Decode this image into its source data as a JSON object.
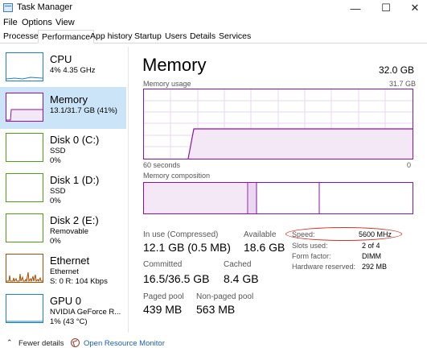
{
  "window": {
    "title": "Task Manager",
    "controls": {
      "minimize": "—",
      "maximize": "☐",
      "close": "✕"
    }
  },
  "menu": [
    "File",
    "Options",
    "View"
  ],
  "tabs": [
    {
      "label": "Processes",
      "active": false
    },
    {
      "label": "Performance",
      "active": true
    },
    {
      "label": "App history",
      "active": false
    },
    {
      "label": "Startup",
      "active": false
    },
    {
      "label": "Users",
      "active": false
    },
    {
      "label": "Details",
      "active": false
    },
    {
      "label": "Services",
      "active": false
    }
  ],
  "sidebar": {
    "items": [
      {
        "title": "CPU",
        "line1": "4% 4.35 GHz",
        "line2": "",
        "kind": "cpu",
        "selected": false
      },
      {
        "title": "Memory",
        "line1": "13.1/31.7 GB (41%)",
        "line2": "",
        "kind": "mem",
        "selected": true
      },
      {
        "title": "Disk 0 (C:)",
        "line1": "SSD",
        "line2": "0%",
        "kind": "disk",
        "selected": false
      },
      {
        "title": "Disk 1 (D:)",
        "line1": "SSD",
        "line2": "0%",
        "kind": "disk",
        "selected": false
      },
      {
        "title": "Disk 2 (E:)",
        "line1": "Removable",
        "line2": "0%",
        "kind": "disk",
        "selected": false
      },
      {
        "title": "Ethernet",
        "line1": "Ethernet",
        "line2": "S: 0 R: 104 Kbps",
        "kind": "eth",
        "selected": false
      },
      {
        "title": "GPU 0",
        "line1": "NVIDIA GeForce R...",
        "line2": "1% (43 °C)",
        "kind": "gpu",
        "selected": false
      }
    ]
  },
  "main": {
    "title": "Memory",
    "total": "32.0 GB",
    "usage_label": "Memory usage",
    "usage_max": "31.7 GB",
    "time_label": "60 seconds",
    "zero_label": "0",
    "composition_label": "Memory composition",
    "stats": {
      "in_use_label": "In use (Compressed)",
      "in_use_value": "12.1 GB (0.5 MB)",
      "available_label": "Available",
      "available_value": "18.6 GB",
      "committed_label": "Committed",
      "committed_value": "16.5/36.5 GB",
      "cached_label": "Cached",
      "cached_value": "8.4 GB",
      "paged_label": "Paged pool",
      "paged_value": "439 MB",
      "nonpaged_label": "Non-paged pool",
      "nonpaged_value": "563 MB"
    },
    "specs": {
      "speed_label": "Speed:",
      "speed_value": "5600 MHz",
      "slots_label": "Slots used:",
      "slots_value": "2 of 4",
      "form_label": "Form factor:",
      "form_value": "DIMM",
      "hwres_label": "Hardware reserved:",
      "hwres_value": "292 MB"
    }
  },
  "footer": {
    "fewer_details": "Fewer details",
    "open_resource_monitor": "Open Resource Monitor"
  },
  "colors": {
    "memory_accent": "#8b12ae",
    "memory_fill": "#f4e8f7",
    "selected_bg": "#cce4f7",
    "annotation": "#d93025",
    "link": "#1a5fb4"
  }
}
